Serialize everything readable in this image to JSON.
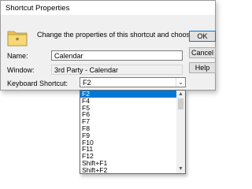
{
  "dialog": {
    "title": "Shortcut Properties",
    "description": "Change the properties of this shortcut and choose OK.",
    "name_label": "Name:",
    "name_value": "Calendar",
    "window_label": "Window:",
    "window_value": "3rd Party - Calendar",
    "shortcut_label": "Keyboard Shortcut:",
    "shortcut_value": "F2",
    "buttons": {
      "ok": "OK",
      "cancel": "Cancel",
      "help": "Help"
    }
  },
  "dropdown": {
    "options": [
      "F2",
      "F4",
      "F5",
      "F6",
      "F7",
      "F8",
      "F9",
      "F10",
      "F11",
      "F12",
      "Shift+F1",
      "Shift+F2"
    ],
    "selected_index": 0
  },
  "colors": {
    "selection": "#0078d7",
    "folder": "#f6d878"
  },
  "icons": {
    "folder": "folder-star-icon",
    "combo_arrow": "chevron-down-icon"
  }
}
